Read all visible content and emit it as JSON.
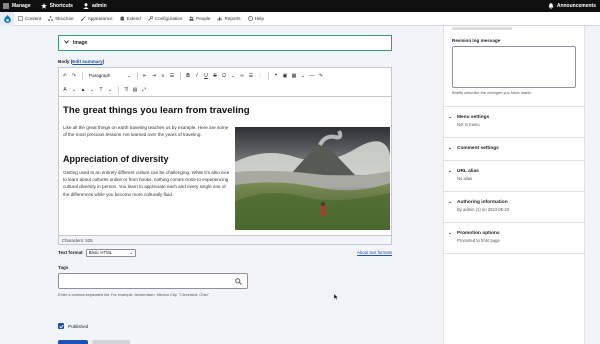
{
  "toolbar": {
    "manage": "Manage",
    "shortcuts": "Shortcuts",
    "user": "admin",
    "announcements": "Announcements"
  },
  "admin_menu": {
    "items": [
      {
        "label": "Content",
        "icon": "file-icon"
      },
      {
        "label": "Structure",
        "icon": "structure-icon"
      },
      {
        "label": "Appearance",
        "icon": "brush-icon"
      },
      {
        "label": "Extend",
        "icon": "puzzle-icon"
      },
      {
        "label": "Configuration",
        "icon": "wrench-icon"
      },
      {
        "label": "People",
        "icon": "people-icon"
      },
      {
        "label": "Reports",
        "icon": "chart-icon"
      },
      {
        "label": "Help",
        "icon": "help-icon"
      }
    ]
  },
  "image_section": {
    "label": "Image"
  },
  "body_field": {
    "label": "Body",
    "summary_link": "Edit summary",
    "heading_select": "Paragraph",
    "heading1": "The great things you learn from traveling",
    "paragraph1": "Like all the great things on earth traveling teaches us by example. Here are some of the most precious lessons I’ve learned over the years of traveling.",
    "heading2": "Appreciation of diversity",
    "paragraph2": "Getting used to an entirely different culture can be challenging. While it’s also nice to learn about cultures online or from books, nothing comes close to experiencing cultural diversity in person. You learn to appreciate each and every single one of the differences while you become more culturally fluid.",
    "char_count": "Characters: 525"
  },
  "text_format": {
    "label": "Text format",
    "value": "Basic HTML",
    "help_link": "About text formats"
  },
  "tags": {
    "label": "Tags",
    "value": "",
    "help": "Enter a comma-separated list. For example: Amsterdam, Mexico City, \"Cleveland, Ohio\""
  },
  "published": {
    "label": "Published",
    "checked": true
  },
  "sidebar": {
    "revision_label": "Revision log message",
    "revision_help": "Briefly describe the changes you have made.",
    "sections": [
      {
        "title": "Menu settings",
        "sub": "Not in menu"
      },
      {
        "title": "Comment settings",
        "sub": ""
      },
      {
        "title": "URL alias",
        "sub": "No alias"
      },
      {
        "title": "Authoring information",
        "sub": "By admin (1) on 2024-05-23"
      },
      {
        "title": "Promotion options",
        "sub": "Promoted to front page"
      }
    ]
  },
  "colors": {
    "accent": "#1a52b8",
    "focus_border": "#3c9b6f",
    "toolbar_bg": "#0f0f0f"
  }
}
